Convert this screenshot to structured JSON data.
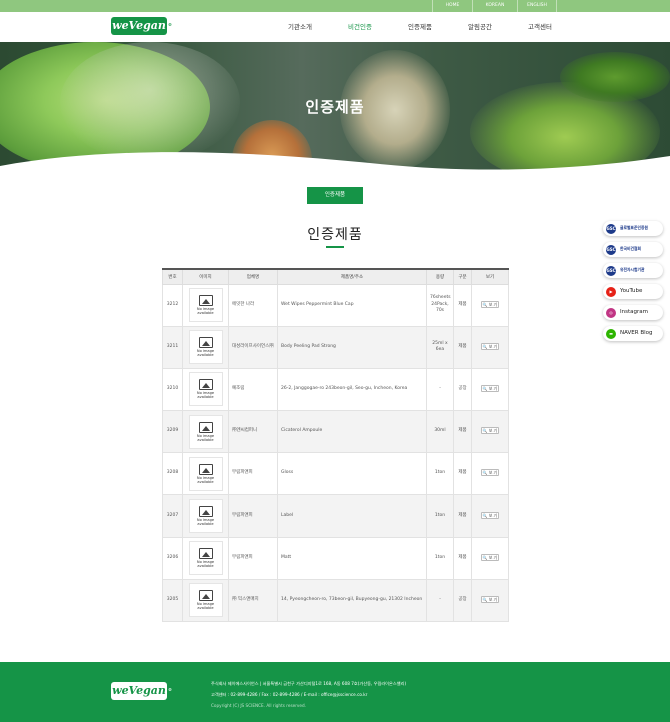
{
  "topbar": {
    "links": [
      "HOME",
      "KOREAN",
      "ENGLISH"
    ]
  },
  "header": {
    "logo_text": "weVegan",
    "logo_mark": "®",
    "nav": [
      {
        "label": "기관소개",
        "active": false
      },
      {
        "label": "비건인증",
        "active": true
      },
      {
        "label": "인증제품",
        "active": false
      },
      {
        "label": "알림공간",
        "active": false
      },
      {
        "label": "고객센터",
        "active": false
      }
    ]
  },
  "hero": {
    "title": "인증제품"
  },
  "subtab": {
    "label": "인증제품"
  },
  "section": {
    "title": "인증제품"
  },
  "table": {
    "headers": [
      "번호",
      "이미지",
      "업체명",
      "제품명/주소",
      "용량",
      "구분",
      "보기"
    ],
    "no_image_line1": "No image",
    "no_image_line2": "available",
    "view_label": "🔍 보 기",
    "rows": [
      {
        "no": "3212",
        "company": "에잇한 나라",
        "product": "Wet Wipes Peppermint Blue Cap",
        "volume": "76sheets 24Pack, 70s",
        "type": "제품"
      },
      {
        "no": "3211",
        "company": "대성라이프사이언스㈜",
        "product": "Body Peeling Pad Strong",
        "volume": "25ml x 6ea",
        "type": "제품"
      },
      {
        "no": "3210",
        "company": "예조림",
        "product": "26-2, Janggogae-ro 243beon-gil, Seo-gu, Incheon, Korea",
        "volume": "-",
        "type": "공장"
      },
      {
        "no": "3209",
        "company": "㈜엔씨컴퍼니",
        "product": "Cicaterol Ampoule",
        "volume": "30ml",
        "type": "제품"
      },
      {
        "no": "3208",
        "company": "무림피앤피",
        "product": "Gloss",
        "volume": "1ton",
        "type": "제품"
      },
      {
        "no": "3207",
        "company": "무림피앤피",
        "product": "Label",
        "volume": "1ton",
        "type": "제품"
      },
      {
        "no": "3206",
        "company": "무림피앤피",
        "product": "Matt",
        "volume": "1ton",
        "type": "제품"
      },
      {
        "no": "3205",
        "company": "㈜ 믹스앤매치",
        "product": "14, Pyeongcheon-ro, 73beon-gil, Bupyeong-gu, 21302 Incheon",
        "volume": "-",
        "type": "공장"
      }
    ]
  },
  "quick_links": [
    {
      "label": "글로벌표준인증원",
      "tag": "GSC",
      "icon": "gsc-cert-icon",
      "color": "#1d3a8a"
    },
    {
      "label": "한국비건협회",
      "tag": "GSC",
      "icon": "gsc-vegan-icon",
      "color": "#1d3a8a"
    },
    {
      "label": "유전자시험기관",
      "tag": "GSC",
      "icon": "gsc-dna-icon",
      "color": "#1d3a8a"
    },
    {
      "label": "YouTube",
      "icon": "youtube-icon",
      "color": "#e62117"
    },
    {
      "label": "Instagram",
      "icon": "instagram-icon",
      "color": "#c13584"
    },
    {
      "label": "NAVER Blog",
      "icon": "naver-blog-icon",
      "color": "#2db400"
    }
  ],
  "footer": {
    "logo_text": "weVegan",
    "logo_mark": "®",
    "line1": "주식회사 제이에스사이언스  |  서울특별시 금천구 가산디지털1로 168, A동 608 7호(가산동, 우림라이온스밸리)",
    "line2": "고객센터 : 02-899-4286 / Fax : 02-899-4286 / E-mail : office@jsscience.co.kr",
    "copyright": "Copyright (C) JS SCIENCE. All rights reserved."
  },
  "colors": {
    "brand_green": "#159447",
    "topbar_green": "#8fc77f"
  }
}
